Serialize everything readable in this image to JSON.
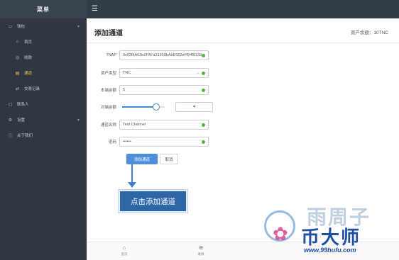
{
  "sidebar": {
    "title": "菜单",
    "items": [
      {
        "icon": "wallet-icon",
        "glyph": "▭",
        "label": "钱包",
        "caret": "▾",
        "level": 0,
        "active": false
      },
      {
        "icon": "home-icon",
        "glyph": "⌂",
        "label": "首页",
        "level": 1,
        "active": false
      },
      {
        "icon": "receive-icon",
        "glyph": "◎",
        "label": "收款",
        "level": 1,
        "active": false
      },
      {
        "icon": "channel-icon",
        "glyph": "▤",
        "label": "通道",
        "level": 1,
        "active": true
      },
      {
        "icon": "transfer-icon",
        "glyph": "⇄",
        "label": "交易记录",
        "level": 1,
        "active": false
      },
      {
        "icon": "contacts-icon",
        "glyph": "▢",
        "label": "联系人",
        "level": 0,
        "active": false
      },
      {
        "icon": "settings-icon",
        "glyph": "⚙",
        "label": "设置",
        "caret": "▾",
        "level": 0,
        "active": false
      },
      {
        "icon": "info-icon",
        "glyph": "ⓘ",
        "label": "关于我们",
        "level": 0,
        "active": false
      }
    ]
  },
  "topbar": {
    "menu_glyph": "☰"
  },
  "page": {
    "title": "添加通道",
    "balance": "资产余额：10TNC"
  },
  "form": {
    "tnap": {
      "label": "TNAP",
      "value": "0x92f8A63b1FAFa31959bA5E662ef494f9139"
    },
    "asset_type": {
      "label": "资产类型",
      "value": "TNC"
    },
    "my_deposit": {
      "label": "本端余额",
      "value": "5"
    },
    "peer_deposit": {
      "label": "对端余额",
      "value": "4",
      "slider_fraction": 0.8
    },
    "channel_name": {
      "label": "通道名称",
      "value": "Test Channel"
    },
    "password": {
      "label": "密码",
      "value": "••••••"
    }
  },
  "buttons": {
    "add": "添加通道",
    "cancel": "取消"
  },
  "callout": {
    "text": "点击添加通道"
  },
  "tabbar": [
    {
      "icon": "home-icon",
      "glyph": "⌂",
      "label": "首页"
    },
    {
      "icon": "receive-icon",
      "glyph": "⊕",
      "label": "收款"
    }
  ],
  "watermark": {
    "line1": "雨周子",
    "line2": "币大师",
    "url": "www.99hufu.com"
  },
  "colors": {
    "sidebar": "#2f3842",
    "topbar": "#323c46",
    "accent": "#4e8fd9",
    "active": "#f5c04a",
    "valid": "#56b33f",
    "callout": "#2f66a6"
  }
}
